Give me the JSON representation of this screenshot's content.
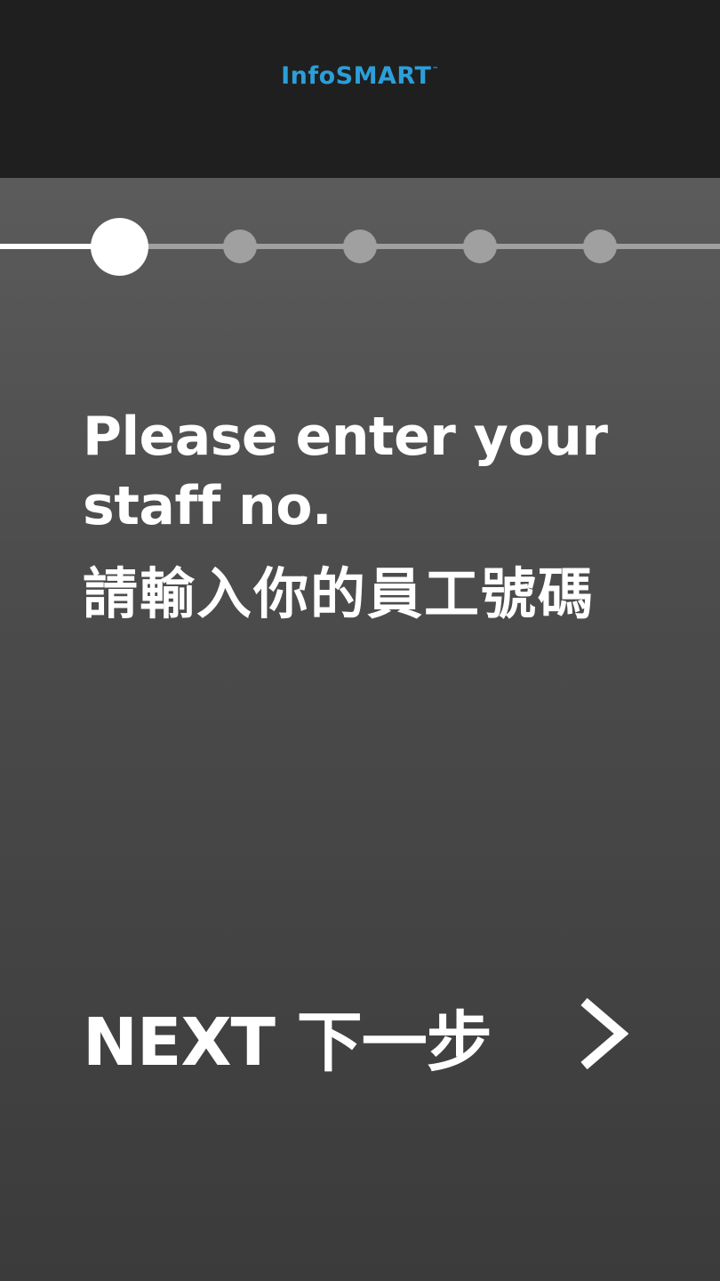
{
  "header": {
    "logo_text": "InfoSMART",
    "logo_mark": "™",
    "logo_color": "#2b9fd9",
    "background": "#1f1f1f"
  },
  "progress": {
    "current_step": 1,
    "total_steps": 5
  },
  "prompt": {
    "english_line1": "Please enter your",
    "english_line2": "staff no.",
    "chinese": "請輸入你的員工號碼"
  },
  "next_button": {
    "label": "NEXT 下一步",
    "icon": "chevron-right-icon"
  }
}
